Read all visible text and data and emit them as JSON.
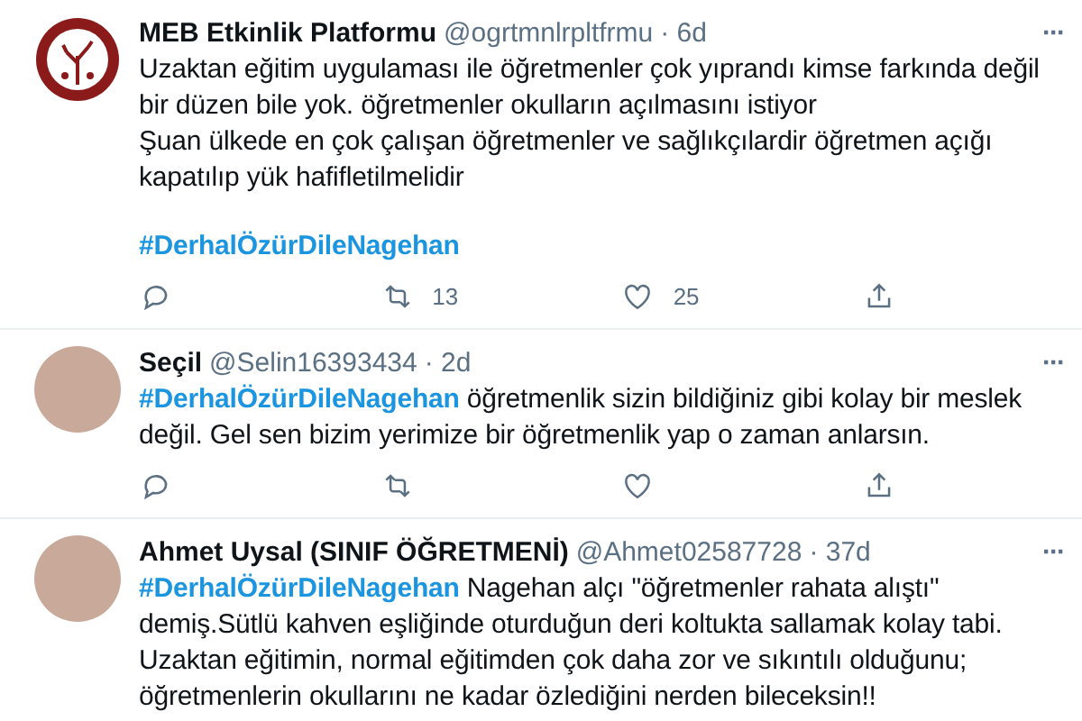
{
  "tweets": [
    {
      "avatar": {
        "kind": "logo"
      },
      "name": "MEB Etkinlik Platformu",
      "handle": "@ogrtmnlrpltfrmu",
      "time": "· 6d",
      "more": "···",
      "paragraphs": [
        [
          {
            "kind": "text",
            "text": "Uzaktan eğitim uygulaması ile öğretmenler çok yıprandı kimse farkında değil bir düzen bile yok. öğretmenler okulların açılmasını istiyor"
          }
        ],
        [
          {
            "kind": "text",
            "text": "Şuan ülkede en çok çalışan öğretmenler ve sağlıkçılardir  öğretmen açığı kapatılıp yük hafifletilmelidir"
          }
        ],
        [
          {
            "kind": "gap"
          }
        ],
        [
          {
            "kind": "hashtag",
            "text": "#DerhalÖzürDileNagehan"
          }
        ]
      ],
      "actions": {
        "retweets": "13",
        "likes": "25"
      }
    },
    {
      "avatar": {
        "kind": "photo"
      },
      "name": "Seçil",
      "handle": "@Selin16393434",
      "time": "· 2d",
      "more": "···",
      "paragraphs": [
        [
          {
            "kind": "hashtag",
            "text": "#DerhalÖzürDileNagehan"
          },
          {
            "kind": "text",
            "text": " öğretmenlik sizin bildiğiniz gibi kolay bir meslek değil. Gel sen bizim yerimize bir öğretmenlik yap o zaman anlarsın."
          }
        ]
      ]
    },
    {
      "avatar": {
        "kind": "photo"
      },
      "name": "Ahmet Uysal (SINIF ÖĞRETMENİ)",
      "handle": "@Ahmet02587728",
      "time": "· 37d",
      "more": "···",
      "paragraphs": [
        [
          {
            "kind": "hashtag",
            "text": "#DerhalÖzürDileNagehan"
          },
          {
            "kind": "text",
            "text": " Nagehan alçı \"öğretmenler rahata alıştı\" demiş.Sütlü kahven eşliğinde oturduğun deri koltukta sallamak kolay tabi. Uzaktan eğitimin, normal eğitimden çok daha zor ve sıkıntılı olduğunu; öğretmenlerin okullarını ne kadar özlediğini nerden bileceksin!!"
          }
        ]
      ]
    }
  ]
}
